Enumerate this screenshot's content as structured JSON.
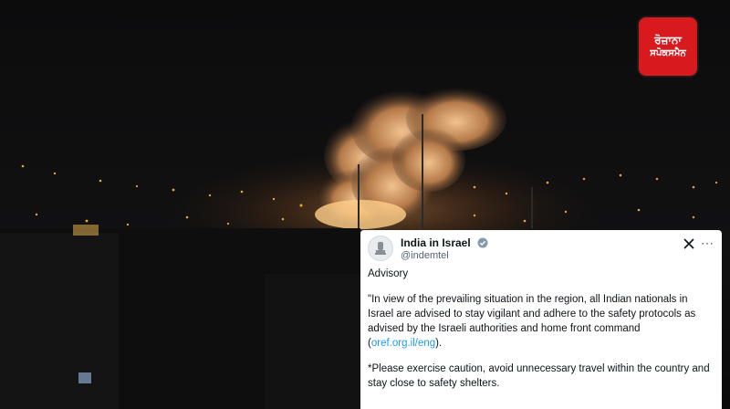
{
  "logo": {
    "line1": "ਰੋਜ਼ਾਨਾ",
    "line2": "ਸਪੋਕਸਮੈਨ",
    "color": "#d8191e"
  },
  "tweet": {
    "account_name": "India in Israel",
    "handle": "@indemtel",
    "advisory_title": "Advisory",
    "paragraph1": "\"In view of the prevailing situation in the region, all Indian nationals in Israel are advised to stay vigilant and adhere to the safety protocols as advised by the Israeli authorities and home front command (",
    "link_text": "oref.org.il/eng",
    "paragraph1_end": ").",
    "paragraph2": "*Please exercise caution, avoid unnecessary travel within the country and stay close to safety shelters.",
    "link_color": "#1d9bf0"
  }
}
